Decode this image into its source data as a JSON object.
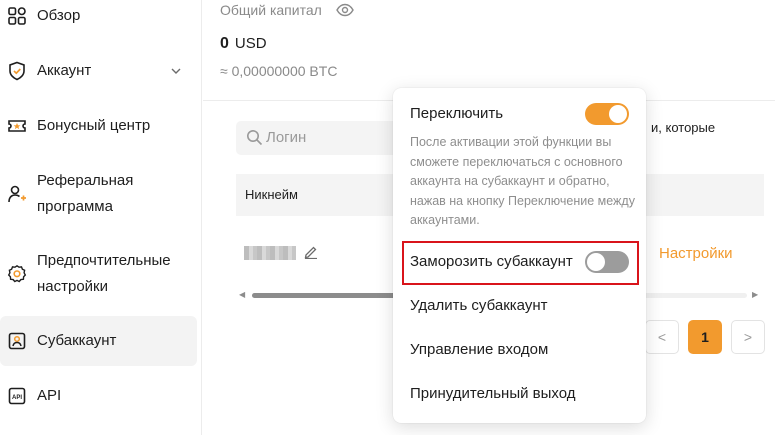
{
  "sidebar": {
    "items": [
      {
        "label": "Обзор",
        "icon": "grid-icon"
      },
      {
        "label": "Аккаунт",
        "icon": "shield-icon"
      },
      {
        "label": "Бонусный центр",
        "icon": "ticket-icon"
      },
      {
        "label_line1": "Реферальная",
        "label_line2": "программа",
        "icon": "referral-user-icon"
      },
      {
        "label_line1": "Предпочтительные",
        "label_line2": "настройки",
        "icon": "gear-icon"
      },
      {
        "label": "Субаккаунт",
        "icon": "user-card-icon",
        "active": true
      },
      {
        "label": "API",
        "icon": "api-icon"
      }
    ]
  },
  "account": {
    "capital_title": "Общий капитал",
    "balance_value": "0",
    "balance_currency": "USD",
    "btc_value": "≈ 0,00000000 BTC"
  },
  "search": {
    "placeholder": "Логин"
  },
  "hint_text": "и, которые",
  "table": {
    "header_nickname": "Никнейм",
    "settings_link": "Настройки",
    "dots_link": "."
  },
  "pagination": {
    "prev": "<",
    "current": "1",
    "next": ">"
  },
  "menu": {
    "switch_label": "Переключить",
    "switch_on": true,
    "description": "После активации этой функции вы сможете переключаться с основного аккаунта на субаккаунт и обратно, нажав на кнопку Переключение между аккаунтами.",
    "freeze_label": "Заморозить субаккаунт",
    "freeze_on": false,
    "delete_label": "Удалить субаккаунт",
    "login_mgmt_label": "Управление входом",
    "force_logout_label": "Принудительный выход"
  },
  "colors": {
    "accent": "#f29a2e",
    "highlight": "#d9141b"
  }
}
